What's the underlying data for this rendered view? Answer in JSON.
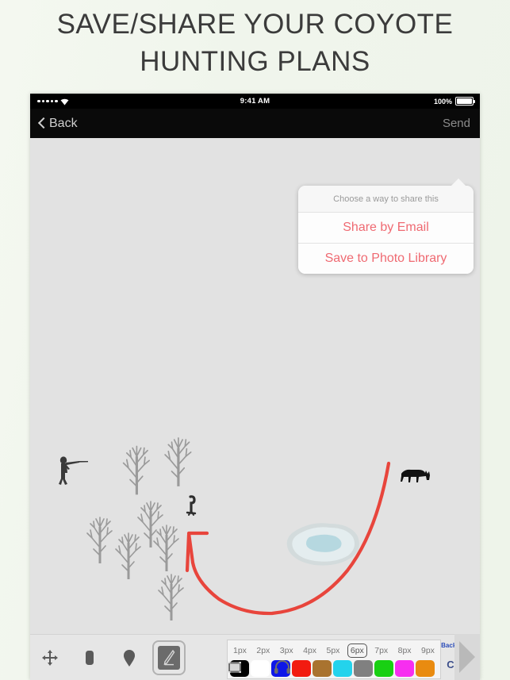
{
  "headline": {
    "line1": "SAVE/SHARE YOUR COYOTE",
    "line2": "HUNTING PLANS"
  },
  "status_bar": {
    "signal_dots": 5,
    "wifi_icon": "wifi-icon",
    "time": "9:41 AM",
    "battery_percent": "100%",
    "battery_icon": "battery-full-icon"
  },
  "nav_bar": {
    "back_label": "Back",
    "back_icon": "chevron-left-icon",
    "send_label": "Send"
  },
  "share_popover": {
    "title": "Choose a way to share this",
    "options": [
      {
        "label": "Share by Email"
      },
      {
        "label": "Save to Photo Library"
      }
    ],
    "accent_color": "#ef6a72"
  },
  "canvas": {
    "background_color": "#e2e2e2",
    "annotation_color": "#e8453c",
    "items": [
      {
        "name": "hunter-with-rifle"
      },
      {
        "name": "bare-tree"
      },
      {
        "name": "pond"
      },
      {
        "name": "coyote-silhouette"
      },
      {
        "name": "game-call"
      },
      {
        "name": "red-approach-arrow"
      }
    ]
  },
  "toolbar": {
    "tools": [
      {
        "name": "move-tool",
        "icon": "move-arrows-icon",
        "selected": false
      },
      {
        "name": "eraser-tool",
        "icon": "eraser-icon",
        "selected": false
      },
      {
        "name": "marker-tool",
        "icon": "map-pin-icon",
        "selected": false
      },
      {
        "name": "draw-tool",
        "icon": "pencil-icon",
        "selected": true
      }
    ],
    "stroke_sizes": [
      "1px",
      "2px",
      "3px",
      "4px",
      "5px",
      "6px",
      "7px",
      "8px",
      "9px"
    ],
    "selected_stroke": "6px",
    "colors": [
      {
        "name": "black",
        "hex": "#000000"
      },
      {
        "name": "white",
        "hex": "#ffffff"
      },
      {
        "name": "blue",
        "hex": "#0e16e8"
      },
      {
        "name": "red",
        "hex": "#f21b10"
      },
      {
        "name": "brown",
        "hex": "#a9732f"
      },
      {
        "name": "cyan",
        "hex": "#24d3ec"
      },
      {
        "name": "gray",
        "hex": "#808080"
      },
      {
        "name": "green",
        "hex": "#19d013"
      },
      {
        "name": "magenta",
        "hex": "#f72ef0"
      },
      {
        "name": "orange",
        "hex": "#e98b10"
      }
    ],
    "selected_color": "black",
    "background_label": "Background",
    "clear_label": "Clear",
    "next_icon": "triangle-right-icon"
  },
  "bottom_bar": {
    "icons": [
      {
        "name": "video-icon"
      },
      {
        "name": "headphones-icon"
      }
    ]
  }
}
